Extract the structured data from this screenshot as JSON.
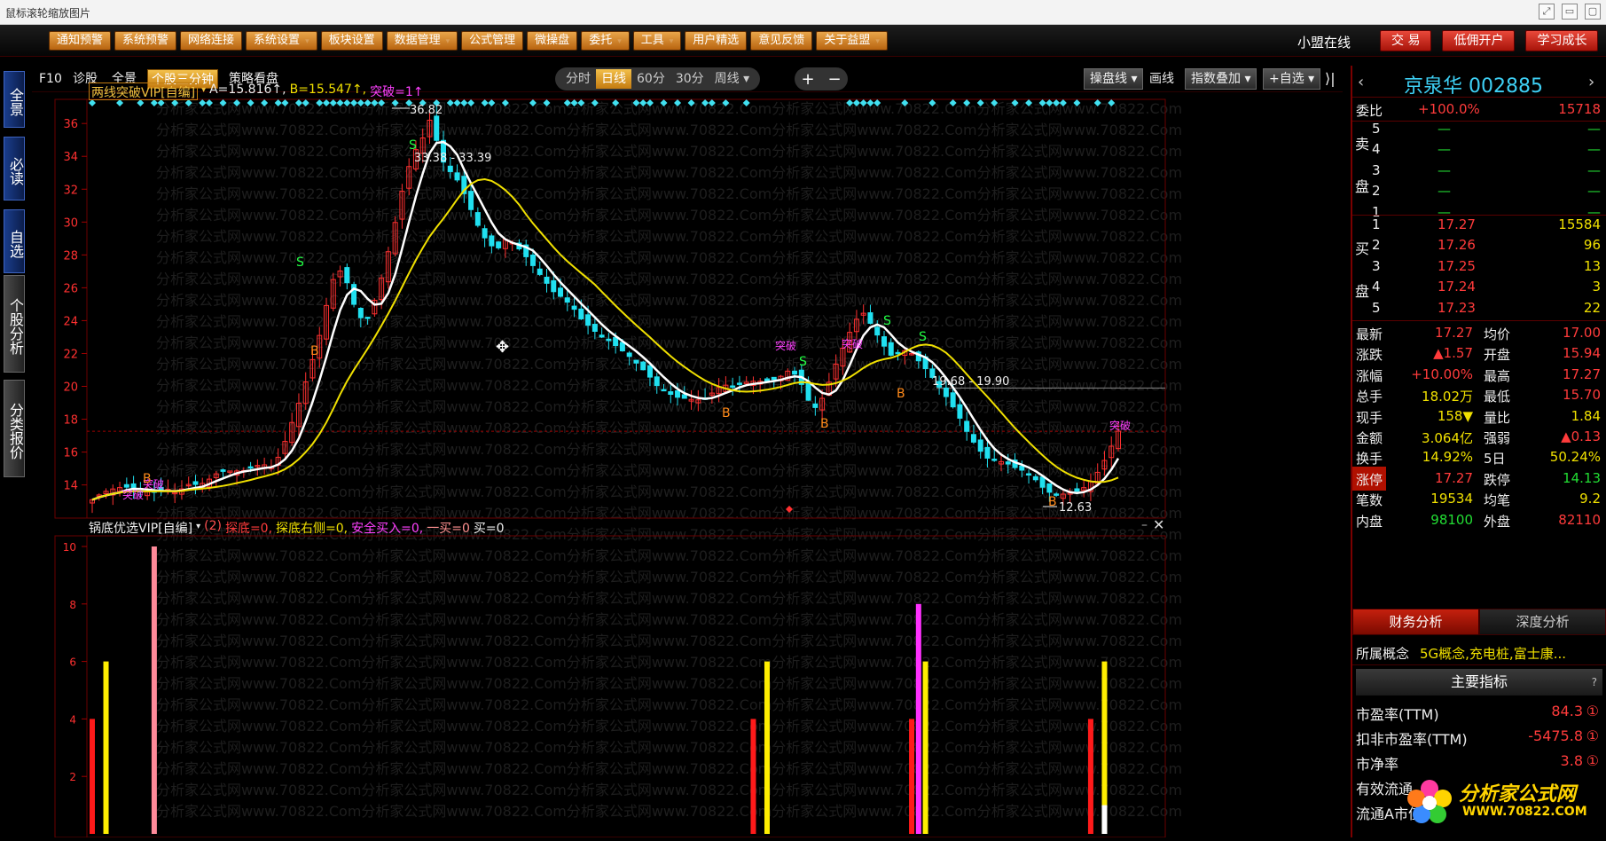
{
  "window": {
    "title": "鼠标滚轮缩放图片",
    "buttons": [
      "⤢",
      "▭",
      "▢"
    ]
  },
  "menubar": {
    "items": [
      {
        "label": "通知预警",
        "dd": false
      },
      {
        "label": "系统预警",
        "dd": false
      },
      {
        "label": "网络连接",
        "dd": false
      },
      {
        "label": "系统设置",
        "dd": true
      },
      {
        "label": "板块设置",
        "dd": false
      },
      {
        "label": "数据管理",
        "dd": true
      },
      {
        "label": "公式管理",
        "dd": false
      },
      {
        "label": "微操盘",
        "dd": false
      },
      {
        "label": "委托",
        "dd": true
      },
      {
        "label": "工具",
        "dd": true
      },
      {
        "label": "用户精选",
        "dd": false
      },
      {
        "label": "意见反馈",
        "dd": false
      },
      {
        "label": "关于益盟",
        "dd": true
      }
    ],
    "online": "小盟在线",
    "right_buttons": [
      "交 易",
      "低佣开户",
      "学习成长"
    ]
  },
  "left_tabs": [
    "全景",
    "必读",
    "自选",
    "个股分析",
    "分类报价"
  ],
  "chart_tabs": [
    "F10",
    "诊股",
    "全景",
    "个股三分钟",
    "策略看盘"
  ],
  "periods": [
    "分时",
    "日线",
    "60分",
    "30分",
    "周线"
  ],
  "zoom": [
    "+",
    "−"
  ],
  "chart_tools": [
    "操盘线",
    "画线",
    "指数叠加",
    "+自选"
  ],
  "main_indicator": {
    "name": "两线突破VIP[自编]",
    "a_label": "A=15.816↑,",
    "b_label": "B=15.547↑,",
    "tupo_label": "突破=1↑"
  },
  "sub_indicator": {
    "name": "锅底优选VIP[自编]",
    "num": "(2)",
    "l1": "探底=0,",
    "l2": "探底右侧=0,",
    "l3": "安全买入=0,",
    "l4": "一买=0",
    "l5": "买=0"
  },
  "annotations": {
    "high": "36.82",
    "low": "12.63",
    "range1": "33.38 - 33.39",
    "range2": "19.68 - 19.90",
    "tupo": "突破",
    "s": "S",
    "b": "B"
  },
  "watermark_text": "分析家公式网www.70822.Com",
  "chart_data": {
    "type": "candlestick",
    "y_ticks": [
      "36",
      "34",
      "32",
      "30",
      "28",
      "26",
      "24",
      "22",
      "20",
      "18",
      "16",
      "14"
    ],
    "ylim": [
      12.63,
      36.82
    ],
    "sub_y_ticks": [
      "10",
      "8",
      "6",
      "4",
      "2"
    ],
    "colors": {
      "up": "#ff3030",
      "down": "#20e0f0",
      "ma1": "#ffffff",
      "ma2": "#f0e000"
    },
    "close": [
      13.1,
      13.3,
      13.4,
      13.5,
      13.6,
      13.5,
      13.7,
      13.9,
      14.1,
      13.8,
      14.2,
      14.0,
      13.9,
      14.3,
      14.5,
      14.6,
      14.8,
      15.2,
      15.6,
      15.4,
      16.2,
      17.6,
      19.0,
      20.6,
      22.4,
      24.9,
      27.1,
      26.4,
      24.8,
      24.1,
      25.6,
      27.4,
      29.6,
      32.0,
      33.8,
      34.6,
      36.1,
      33.7,
      33.1,
      32.6,
      31.4,
      30.1,
      29.0,
      28.4,
      28.9,
      28.3,
      27.6,
      26.9,
      26.3,
      25.8,
      25.6,
      25.2,
      24.4,
      23.8,
      23.1,
      22.6,
      22.0,
      21.5,
      21.0,
      20.6,
      20.1,
      19.9,
      19.7,
      19.6,
      19.4,
      19.2,
      19.5,
      19.8,
      19.6,
      19.9,
      20.2,
      20.4,
      20.6,
      20.9,
      21.3,
      20.8,
      19.2,
      18.4,
      19.5,
      21.0,
      22.4,
      23.9,
      24.6,
      23.8,
      22.9,
      22.1,
      22.4,
      22.0,
      21.2,
      20.4,
      19.6,
      18.9,
      18.2,
      17.3,
      16.6,
      16.0,
      15.8,
      15.5,
      15.0,
      14.6,
      14.1,
      13.5,
      13.2,
      13.4,
      13.7,
      14.0,
      14.5,
      15.2,
      16.1,
      17.27
    ],
    "sub_values": [
      {
        "i": 0,
        "v": 4,
        "c": "red"
      },
      {
        "i": 2,
        "v": 6,
        "c": "yellow"
      },
      {
        "i": 9,
        "v": 10,
        "c": "pink"
      },
      {
        "i": 96,
        "v": 4,
        "c": "red"
      },
      {
        "i": 98,
        "v": 6,
        "c": "yellow"
      },
      {
        "i": 119,
        "v": 4,
        "c": "red"
      },
      {
        "i": 120,
        "v": 8,
        "c": "magenta"
      },
      {
        "i": 121,
        "v": 6,
        "c": "yellow"
      },
      {
        "i": 145,
        "v": 4,
        "c": "red"
      },
      {
        "i": 147,
        "v": 6,
        "c": "yellow"
      }
    ]
  },
  "quote": {
    "name": "京泉华",
    "code": "002885",
    "weibi_label": "委比",
    "weibi": "+100.0%",
    "weicha": "15718",
    "sell_label1": "卖",
    "sell_label2": "盘",
    "buy_label1": "买",
    "buy_label2": "盘",
    "sells": [
      {
        "lvl": "5",
        "p": "—",
        "v": "—"
      },
      {
        "lvl": "4",
        "p": "—",
        "v": "—"
      },
      {
        "lvl": "3",
        "p": "—",
        "v": "—"
      },
      {
        "lvl": "2",
        "p": "—",
        "v": "—"
      },
      {
        "lvl": "1",
        "p": "—",
        "v": "—"
      }
    ],
    "buys": [
      {
        "lvl": "1",
        "p": "17.27",
        "v": "15584"
      },
      {
        "lvl": "2",
        "p": "17.26",
        "v": "96"
      },
      {
        "lvl": "3",
        "p": "17.25",
        "v": "13"
      },
      {
        "lvl": "4",
        "p": "17.24",
        "v": "3"
      },
      {
        "lvl": "5",
        "p": "17.23",
        "v": "22"
      }
    ],
    "stats": [
      {
        "l1": "最新",
        "v1": "17.27",
        "c1": "red",
        "l2": "均价",
        "v2": "17.00",
        "c2": "red"
      },
      {
        "l1": "涨跌",
        "v1": "▲1.57",
        "c1": "red",
        "l2": "开盘",
        "v2": "15.94",
        "c2": "red"
      },
      {
        "l1": "涨幅",
        "v1": "+10.00%",
        "c1": "red",
        "l2": "最高",
        "v2": "17.27",
        "c2": "red"
      },
      {
        "l1": "总手",
        "v1": "18.02万",
        "c1": "yellow",
        "l2": "最低",
        "v2": "15.70",
        "c2": "red"
      },
      {
        "l1": "现手",
        "v1": "158▼",
        "c1": "yellow",
        "l2": "量比",
        "v2": "1.84",
        "c2": "yellow"
      },
      {
        "l1": "金额",
        "v1": "3.064亿",
        "c1": "yellow",
        "l2": "强弱",
        "v2": "▲0.13",
        "c2": "red"
      },
      {
        "l1": "换手",
        "v1": "14.92%",
        "c1": "yellow",
        "l2": "5日",
        "v2": "50.24%",
        "c2": "yellow"
      },
      {
        "l1": "涨停",
        "v1": "17.27",
        "c1": "red",
        "l2": "跌停",
        "v2": "14.13",
        "c2": "green"
      },
      {
        "l1": "笔数",
        "v1": "19534",
        "c1": "yellow",
        "l2": "均笔",
        "v2": "9.2",
        "c2": "yellow"
      },
      {
        "l1": "内盘",
        "v1": "98100",
        "c1": "green",
        "l2": "外盘",
        "v2": "82110",
        "c2": "red"
      }
    ],
    "tabs": [
      "财务分析",
      "深度分析"
    ],
    "concept_label": "所属概念",
    "concept_value": "5G概念,充电桩,富士康...",
    "indicators_title": "主要指标",
    "indicators_help": "?",
    "indicators": [
      {
        "label": "市盈率(TTM)",
        "value": "84.3",
        "mark": "①"
      },
      {
        "label": "扣非市盈率(TTM)",
        "value": "-5475.8",
        "mark": "①"
      },
      {
        "label": "市净率",
        "value": "3.8",
        "mark": "①"
      },
      {
        "label": "有效流通",
        "value": "",
        "mark": ""
      },
      {
        "label": "流通A市值",
        "value": "",
        "mark": ""
      }
    ]
  },
  "logo": {
    "name": "分析家公式网",
    "url": "WWW.70822.COM"
  }
}
